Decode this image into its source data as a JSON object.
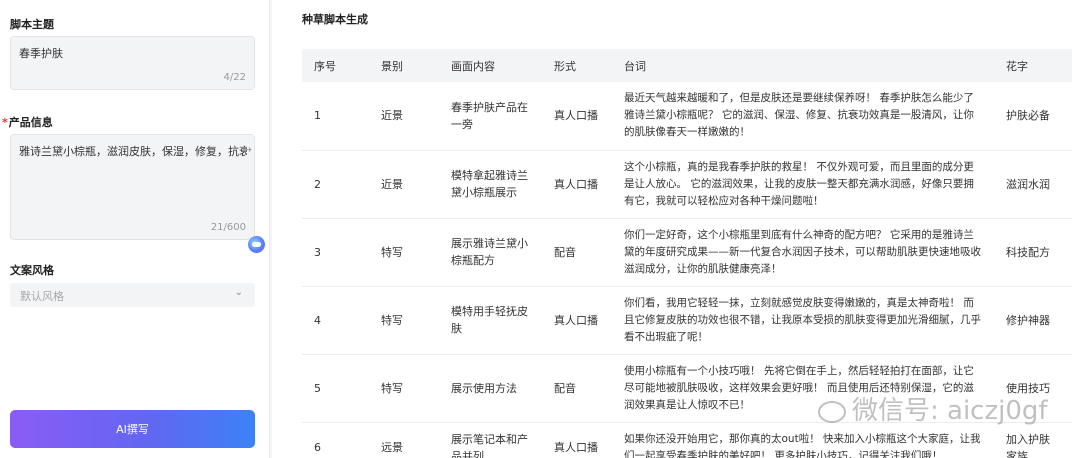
{
  "left": {
    "topic_label": "脚本主题",
    "topic_value": "春季护肤",
    "topic_count": "4/22",
    "required_mark": "*",
    "product_label": "产品信息",
    "product_value": "雅诗兰黛小棕瓶，滋润皮肤，保湿，修复，抗衰",
    "product_arrow": "→",
    "product_count": "21/600",
    "style_label": "文案风格",
    "style_placeholder": "默认风格",
    "style_chevron": "⌄",
    "button_label": "AI撰写"
  },
  "right": {
    "title": "种草脚本生成",
    "headers": [
      "序号",
      "景别",
      "画面内容",
      "形式",
      "台词",
      "花字"
    ],
    "rows": [
      {
        "no": "1",
        "shot": "近景",
        "content": "春季护肤产品在一旁",
        "form": "真人口播",
        "dialogue": "最近天气越来越暖和了，但是皮肤还是要继续保养呀！ 春季护肤怎么能少了雅诗兰黛小棕瓶呢？ 它的滋润、保湿、修复、抗衰功效真是一股清风，让你的肌肤像春天一样嫩嫩的！",
        "caption": "护肤必备"
      },
      {
        "no": "2",
        "shot": "近景",
        "content": "模特拿起雅诗兰黛小棕瓶展示",
        "form": "真人口播",
        "dialogue": "这个小棕瓶，真的是我春季护肤的救星！ 不仅外观可爱，而且里面的成分更是让人放心。 它的滋润效果，让我的皮肤一整天都充满水润感，好像只要拥有它，我就可以轻松应对各种干燥问题啦！",
        "caption": "滋润水润"
      },
      {
        "no": "3",
        "shot": "特写",
        "content": "展示雅诗兰黛小棕瓶配方",
        "form": "配音",
        "dialogue": "你们一定好奇，这个小棕瓶里到底有什么神奇的配方吧？ 它采用的是雅诗兰黛的年度研究成果——新一代复合水润因子技术，可以帮助肌肤更快速地吸收滋润成分，让你的肌肤健康亮泽！",
        "caption": "科技配方"
      },
      {
        "no": "4",
        "shot": "特写",
        "content": "模特用手轻抚皮肤",
        "form": "真人口播",
        "dialogue": "你们看，我用它轻轻一抹，立刻就感觉皮肤变得嫩嫩的，真是太神奇啦！ 而且它修复皮肤的功效也很不错，让我原本受损的肌肤变得更加光滑细腻，几乎看不出瑕疵了呢！",
        "caption": "修护神器"
      },
      {
        "no": "5",
        "shot": "特写",
        "content": "展示使用方法",
        "form": "配音",
        "dialogue": "使用小棕瓶有一个小技巧哦！ 先将它倒在手上，然后轻轻拍打在面部，让它尽可能地被肌肤吸收，这样效果会更好哦！ 而且使用后还特别保湿，它的滋润效果真是让人惊叹不已！",
        "caption": "使用技巧"
      },
      {
        "no": "6",
        "shot": "远景",
        "content": "展示笔记本和产品并列",
        "form": "真人口播",
        "dialogue": "如果你还没开始用它，那你真的太out啦！ 快来加入小棕瓶这个大家庭，让我们一起享受春季护肤的美好吧！ 更多护肤小技巧，记得关注我们哦！",
        "caption": "加入护肤家族"
      }
    ]
  },
  "watermark": "微信号: aiczj0gf"
}
